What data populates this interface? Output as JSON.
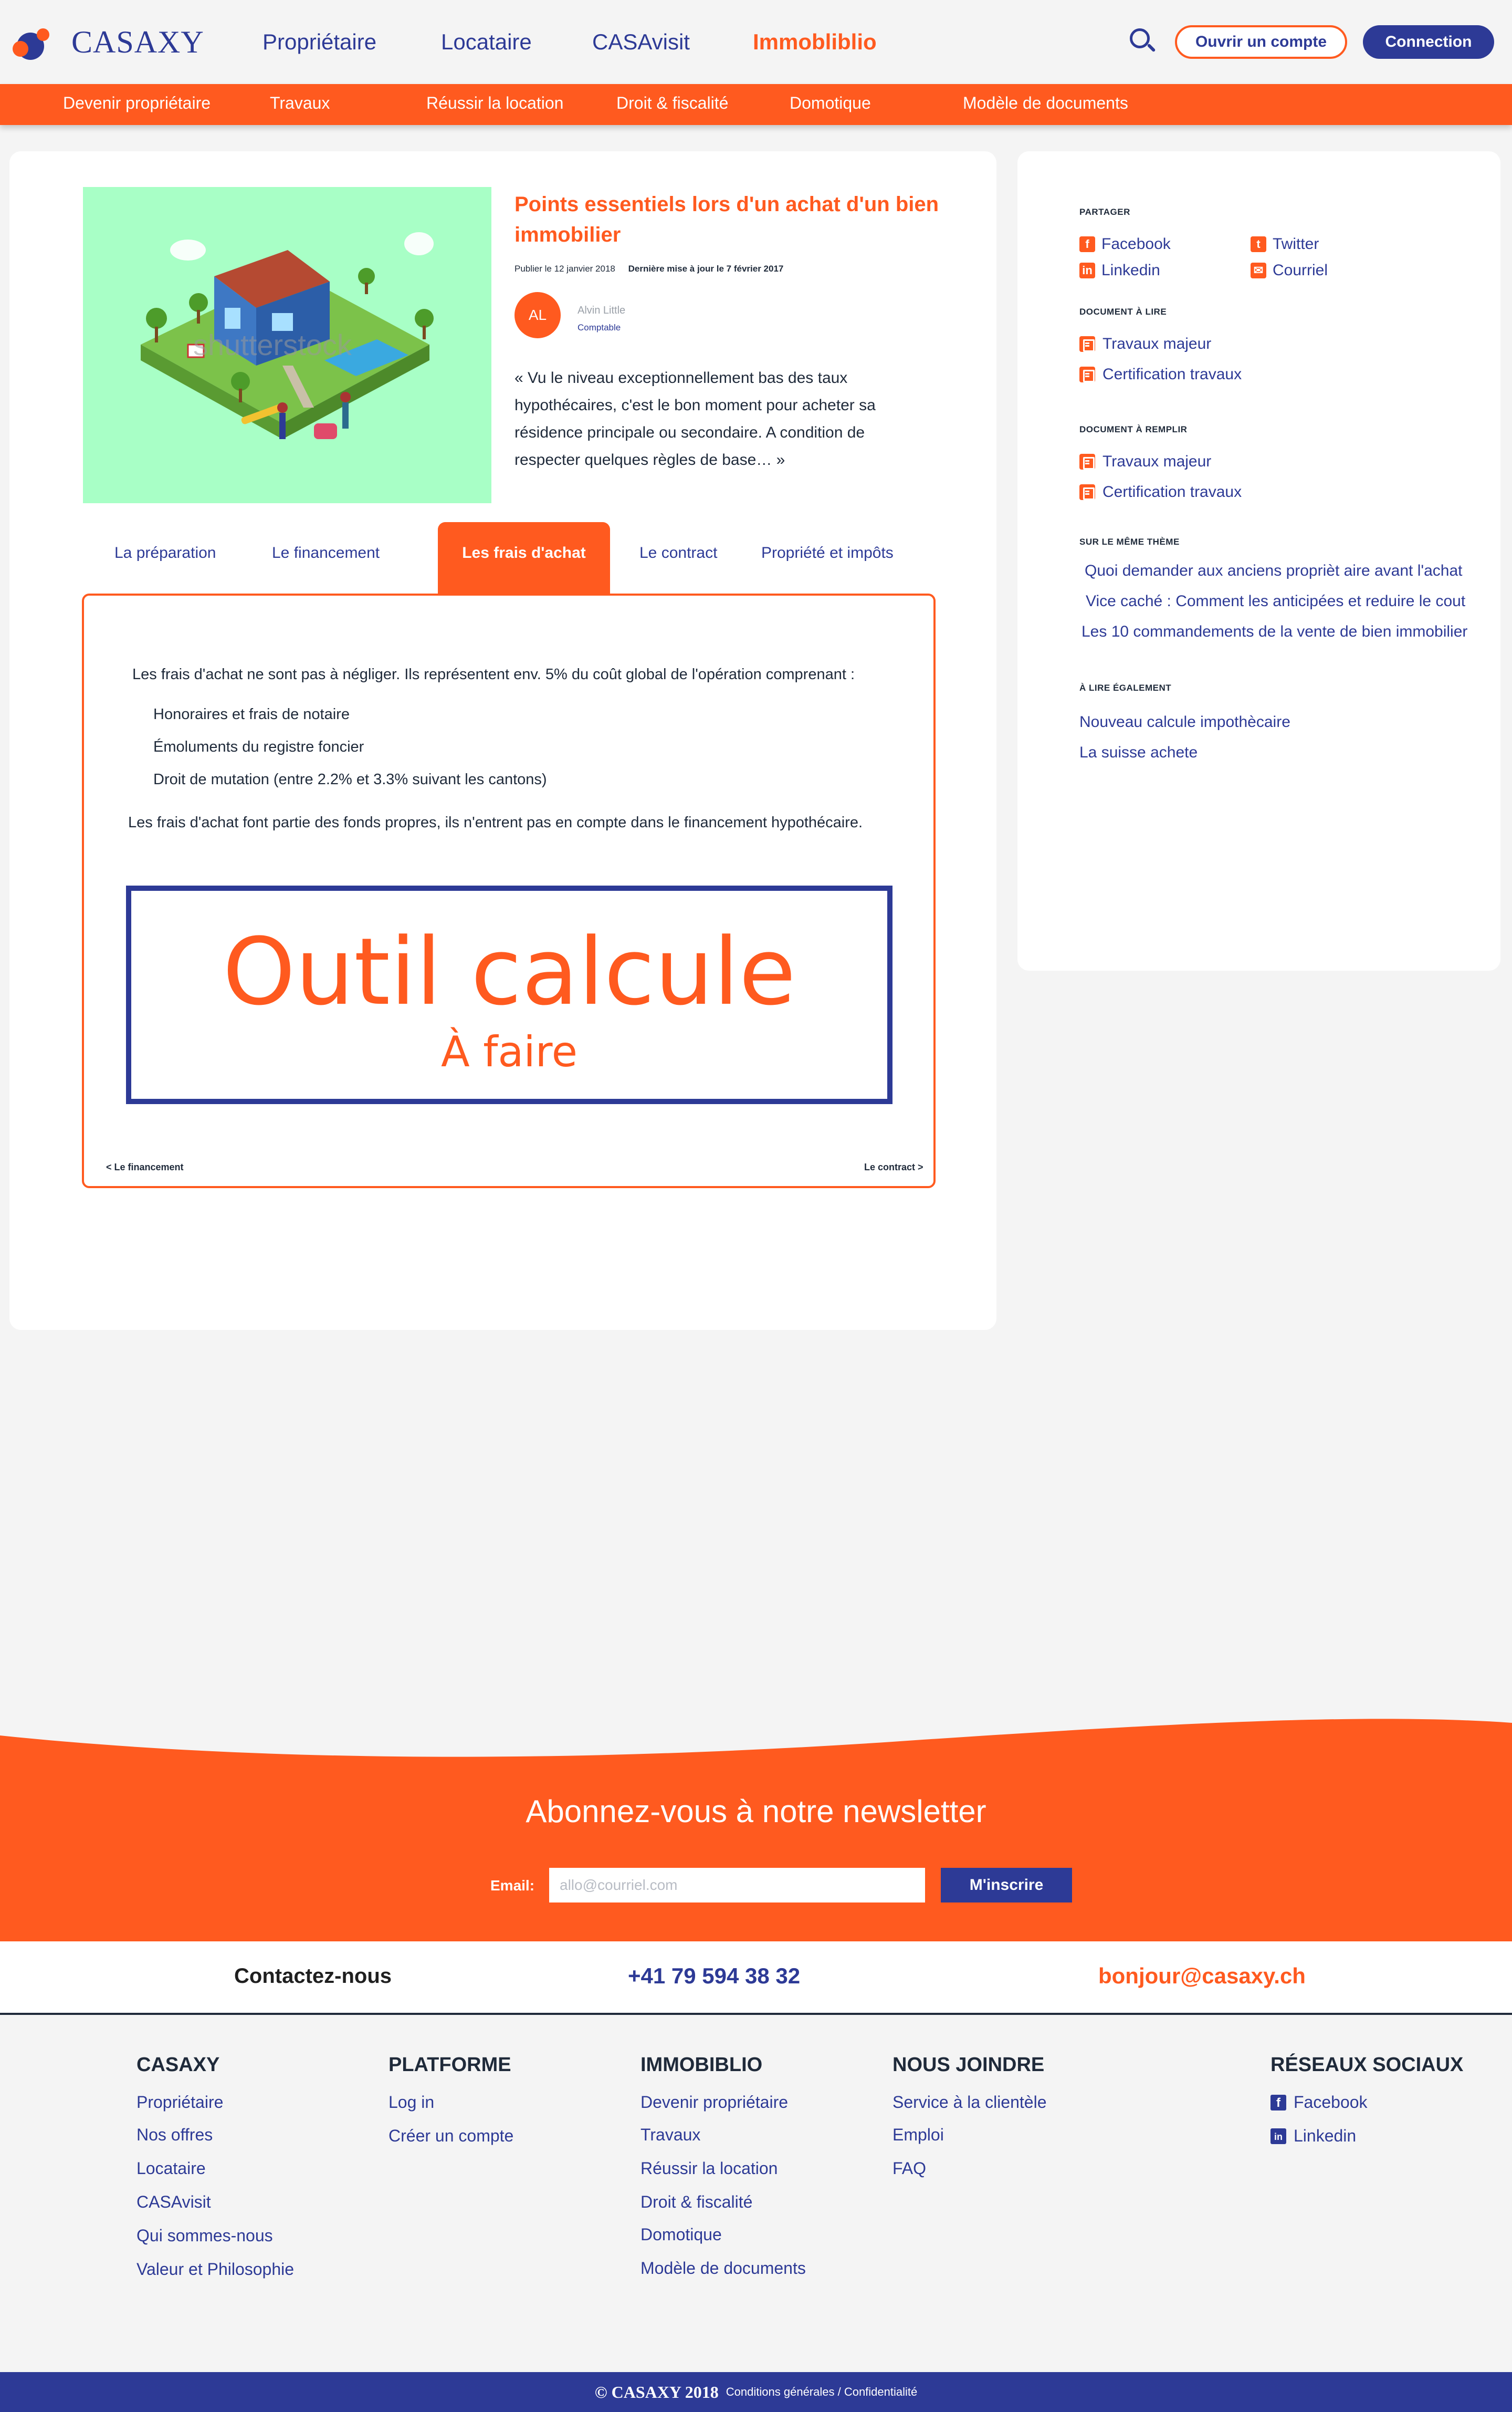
{
  "header": {
    "logo": "CASAXY",
    "nav": [
      "Propriétaire",
      "Locataire",
      "CASAvisit",
      "Immobliblio"
    ],
    "open_account": "Ouvrir un compte",
    "login": "Connection"
  },
  "subnav": [
    "Devenir propriétaire",
    "Travaux",
    "Réussir la location",
    "Droit & fiscalité",
    "Domotique",
    "Modèle de documents"
  ],
  "article": {
    "title": "Points essentiels lors d'un achat d'un bien immobilier",
    "published": "Publier le 12 janvier 2018",
    "updated": "Dernière mise à jour le 7 février 2017",
    "author_initials": "AL",
    "author_name": "Alvin Little",
    "author_role": "Comptable",
    "excerpt": "« Vu le niveau exceptionnellement bas des taux hypothécaires, c'est le bon moment pour acheter sa résidence principale ou secondaire. A condition de respecter quelques règles de base… »",
    "image_watermark": "shutterstock"
  },
  "tabs": [
    "La préparation",
    "Le financement",
    "Les frais d'achat",
    "Le contract",
    "Propriété et impôts"
  ],
  "panel": {
    "intro": "Les frais d'achat ne sont pas à négliger. Ils représentent env. 5% du coût global de l'opération  comprenant  :",
    "items": [
      "Honoraires et frais de notaire",
      "Émoluments du registre foncier",
      "Droit de mutation (entre 2.2% et 3.3% suivant les cantons)"
    ],
    "outro": "Les frais d'achat font partie des fonds propres, ils n'entrent pas en compte dans le financement hypothécaire.",
    "tool_title": "Outil calcule",
    "tool_subtitle": "À faire",
    "prev": "< Le financement",
    "next": "Le contract >"
  },
  "sidebar": {
    "share_heading": "PARTAGER",
    "share": [
      "Facebook",
      "Twitter",
      "Linkedin",
      "Courriel"
    ],
    "read_heading": "DOCUMENT À LIRE",
    "read": [
      "Travaux majeur",
      "Certification travaux"
    ],
    "fill_heading": "DOCUMENT À REMPLIR",
    "fill": [
      "Travaux majeur",
      "Certification travaux"
    ],
    "theme_heading": "SUR LE MÊME THÈME",
    "theme": [
      "Quoi demander aux anciens proprièt aire avant l'achat",
      "Vice caché : Comment les anticipées et reduire le cout",
      "Les 10 commandements de la vente de bien immobilier"
    ],
    "also_heading": "À LIRE ÉGALEMENT",
    "also": [
      "Nouveau calcule impothècaire",
      "La suisse achete"
    ]
  },
  "newsletter": {
    "title": "Abonnez-vous à notre newsletter",
    "email_label": "Email:",
    "placeholder": "allo@courriel.com",
    "button": "M'inscrire"
  },
  "contact": {
    "label": "Contactez-nous",
    "phone": "+41 79 594 38 32",
    "email": "bonjour@casaxy.ch"
  },
  "footer": {
    "casaxy": {
      "title": "CASAXY",
      "links": [
        "Propriétaire",
        "Nos offres",
        "Locataire",
        "CASAvisit",
        "Qui sommes-nous",
        "Valeur et Philosophie"
      ]
    },
    "platforme": {
      "title": "PLATFORME",
      "links": [
        "Log in",
        "Créer un compte"
      ]
    },
    "immobiblio": {
      "title": "IMMOBIBLIO",
      "links": [
        "Devenir propriétaire",
        "Travaux",
        "Réussir la location",
        "Droit & fiscalité",
        "Domotique",
        "Modèle de documents"
      ]
    },
    "joindre": {
      "title": "NOUS JOINDRE",
      "links": [
        "Service à la clientèle",
        "Emploi",
        "FAQ"
      ]
    },
    "social": {
      "title": "RÉSEAUX SOCIAUX",
      "links": [
        "Facebook",
        "Linkedin"
      ]
    },
    "copyright": "© CASAXY 2018",
    "legal": "Conditions générales / Confidentialité"
  },
  "colors": {
    "orange": "#ff5a1f",
    "navy": "#2d3a96",
    "mint": "#a8ffc6"
  }
}
